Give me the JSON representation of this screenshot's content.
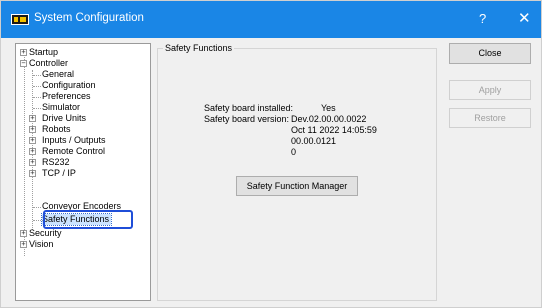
{
  "window": {
    "title": "System Configuration",
    "help_glyph": "?",
    "close_glyph": "✕"
  },
  "tree": {
    "items": [
      {
        "label": "Startup",
        "expander": "+"
      },
      {
        "label": "Controller",
        "expander": "−"
      },
      {
        "label": "General"
      },
      {
        "label": "Configuration"
      },
      {
        "label": "Preferences"
      },
      {
        "label": "Simulator"
      },
      {
        "label": "Drive Units",
        "expander": "+"
      },
      {
        "label": "Robots",
        "expander": "+"
      },
      {
        "label": "Inputs / Outputs",
        "expander": "+"
      },
      {
        "label": "Remote Control",
        "expander": "+"
      },
      {
        "label": "RS232",
        "expander": "+"
      },
      {
        "label": "TCP / IP",
        "expander": "+"
      },
      {
        "label": "Conveyor Encoders"
      },
      {
        "label": "Safety Functions",
        "selected": true
      },
      {
        "label": "Security",
        "expander": "+"
      },
      {
        "label": "Vision",
        "expander": "+"
      }
    ]
  },
  "panel": {
    "group_title": "Safety Functions",
    "installed_label": "Safety board installed:",
    "installed_value": "Yes",
    "version_label": "Safety board version:",
    "version_lines": [
      "Dev.02.00.00.0022",
      "Oct 11 2022 14:05:59",
      "00.00.0121",
      "0"
    ],
    "manager_button": "Safety Function Manager"
  },
  "buttons": {
    "close": "Close",
    "apply": "Apply",
    "restore": "Restore"
  },
  "colors": {
    "titlebar": "#1a86e6",
    "highlight": "#1f4ed8",
    "selection": "#cce4ff"
  }
}
